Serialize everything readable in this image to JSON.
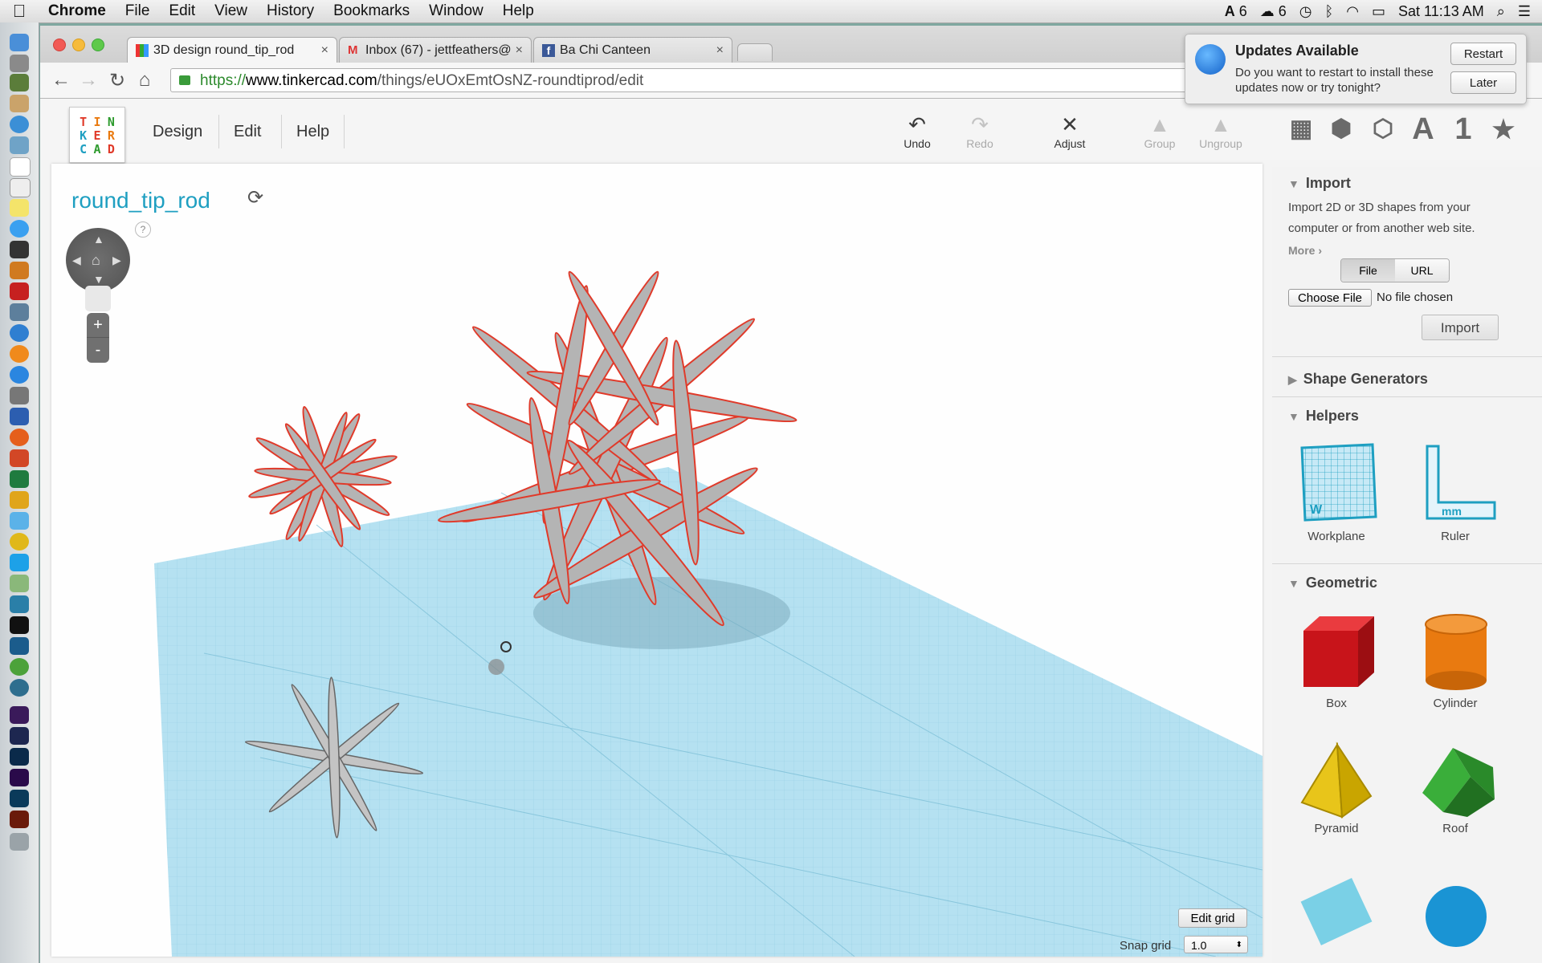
{
  "menubar": {
    "apple": "",
    "items": [
      "Chrome",
      "File",
      "Edit",
      "View",
      "History",
      "Bookmarks",
      "Window",
      "Help"
    ],
    "status": {
      "adobe_count": "6",
      "cloud_count": "6",
      "clock": "Sat 11:13 AM"
    }
  },
  "browser": {
    "tabs": [
      {
        "title": "3D design round_tip_rod",
        "close": "×"
      },
      {
        "title": "Inbox (67) - jettfeathers@",
        "close": "×"
      },
      {
        "title": "Ba Chi Canteen",
        "close": "×"
      }
    ],
    "url": {
      "scheme": "https://",
      "host": "www.tinkercad.com",
      "path": "/things/eUOxEmtOsNZ-roundtiprod/edit"
    }
  },
  "notification": {
    "title": "Updates Available",
    "body": "Do you want to restart to install these updates now or try tonight?",
    "restart": "Restart",
    "later": "Later"
  },
  "tinkercad": {
    "logo_letters": [
      "T",
      "I",
      "N",
      "K",
      "E",
      "R",
      "C",
      "A",
      "D"
    ],
    "menu": [
      "Design",
      "Edit",
      "Help"
    ],
    "tools": {
      "undo": "Undo",
      "redo": "Redo",
      "adjust": "Adjust",
      "group": "Group",
      "ungroup": "Ungroup"
    },
    "categories": {
      "text": "A",
      "number": "1"
    }
  },
  "design": {
    "title": "round_tip_rod",
    "help": "?",
    "zoom_in": "+",
    "zoom_out": "-",
    "edit_grid": "Edit grid",
    "snap_label": "Snap grid",
    "snap_value": "1.0"
  },
  "sidebar": {
    "import": {
      "heading": "Import",
      "desc": "Import 2D or 3D shapes from your computer or from another web site.",
      "more": "More ›",
      "file_tab": "File",
      "url_tab": "URL",
      "choose": "Choose File",
      "no_file": "No file chosen",
      "button": "Import"
    },
    "shape_generators": "Shape Generators",
    "helpers": {
      "heading": "Helpers",
      "items": [
        "Workplane",
        "Ruler"
      ]
    },
    "geometric": {
      "heading": "Geometric",
      "items": [
        "Box",
        "Cylinder",
        "Pyramid",
        "Roof"
      ]
    }
  },
  "colors": {
    "accent": "#1e9fc1",
    "grid": "#a9dcee",
    "selection": "#e03a2a",
    "box": "#d4151b",
    "cylinder": "#e97a10",
    "pyramid": "#e8c51a",
    "roof": "#2e9b2e"
  }
}
